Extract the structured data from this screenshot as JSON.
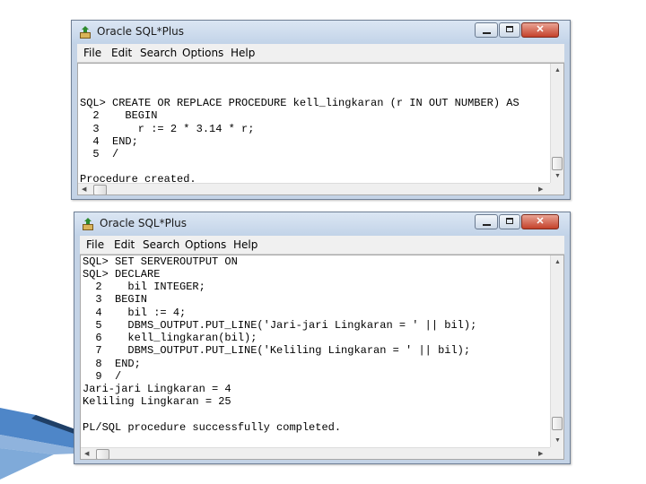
{
  "windows": [
    {
      "title": "Oracle SQL*Plus",
      "menu": [
        "File",
        "Edit",
        "Search",
        "Options",
        "Help"
      ],
      "lines": [
        "SQL> CREATE OR REPLACE PROCEDURE kell_lingkaran (r IN OUT NUMBER) AS",
        "  2    BEGIN",
        "  3      r := 2 * 3.14 * r;",
        "  4  END;",
        "  5  /",
        "",
        "Procedure created."
      ]
    },
    {
      "title": "Oracle SQL*Plus",
      "menu": [
        "File",
        "Edit",
        "Search",
        "Options",
        "Help"
      ],
      "lines": [
        "SQL> SET SERVEROUTPUT ON",
        "SQL> DECLARE",
        "  2    bil INTEGER;",
        "  3  BEGIN",
        "  4    bil := 4;",
        "  5    DBMS_OUTPUT.PUT_LINE('Jari-jari Lingkaran = ' || bil);",
        "  6    kell_lingkaran(bil);",
        "  7    DBMS_OUTPUT.PUT_LINE('Keliling Lingkaran = ' || bil);",
        "  8  END;",
        "  9  /",
        "Jari-jari Lingkaran = 4",
        "Keliling Lingkaran = 25",
        "",
        "PL/SQL procedure successfully completed."
      ]
    }
  ],
  "icons": {
    "app": "sqlplus-app-icon",
    "minimize": "minimize-icon",
    "maximize": "maximize-icon",
    "close": "close-icon",
    "scroll_up": "scroll-up-arrow-icon",
    "scroll_down": "scroll-down-arrow-icon",
    "scroll_left": "scroll-left-arrow-icon",
    "scroll_right": "scroll-right-arrow-icon"
  },
  "colors": {
    "title_bar": "#c4d3e6",
    "close_button": "#c4412a",
    "console_bg": "#ffffff",
    "console_text": "#000000",
    "decoration_blue": "#3b79c2"
  }
}
